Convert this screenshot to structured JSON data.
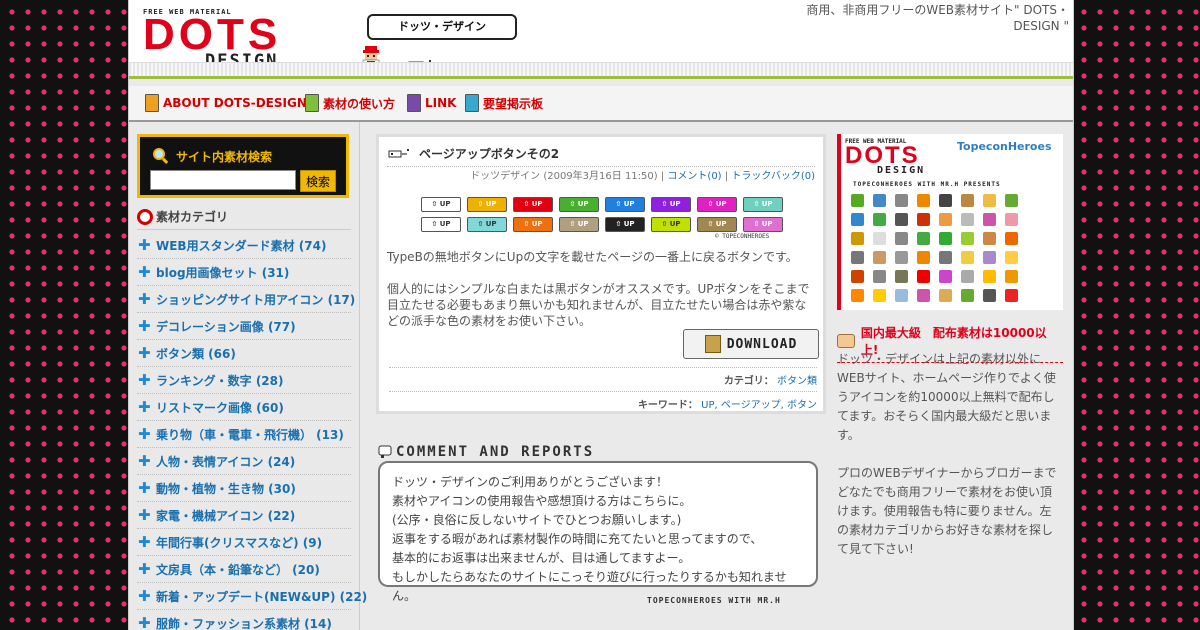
{
  "header": {
    "logo_free": "FREE WEB MATERIAL",
    "logo_dots": "DOTS",
    "logo_design": "DESIGN",
    "speech": "ドッツ・デザイン",
    "tagline": "商用、非商用フリーのWEB素材サイト\" DOTS・DESIGN \""
  },
  "nav": {
    "items": [
      {
        "label": "ABOUT DOTS-DESIGN",
        "color": "#f0a020"
      },
      {
        "label": "素材の使い方",
        "color": "#7dc13a"
      },
      {
        "label": "LINK",
        "color": "#7a4aa8"
      },
      {
        "label": "要望掲示板",
        "color": "#38a8d0"
      }
    ]
  },
  "sidebar": {
    "search_title": "サイト内素材検索",
    "search_button": "検索",
    "category_title": "素材カテゴリ",
    "categories": [
      "WEB用スタンダード素材 (74)",
      "blog用画像セット (31)",
      "ショッピングサイト用アイコン (17)",
      "デコレーション画像 (77)",
      "ボタン類 (66)",
      "ランキング・数字 (28)",
      "リストマーク画像 (60)",
      "乗り物（車・電車・飛行機） (13)",
      "人物・表情アイコン (24)",
      "動物・植物・生き物 (30)",
      "家電・機械アイコン (22)",
      "年間行事(クリスマスなど) (9)",
      "文房具（本・鉛筆など） (20)",
      "新着・アップデート(NEW&UP) (22)",
      "服飾・ファッション系素材 (14)"
    ]
  },
  "post": {
    "title": "ページアップボタンその2",
    "author": "ドッツデザイン",
    "date": "2009年3月16日 11:50",
    "comments": "コメント(0)",
    "trackbacks": "トラックバック(0)",
    "button_label": "UP",
    "credit": "TOPECONHEROES",
    "body_1": "TypeBの無地ボタンにUpの文字を載せたページの一番上に戻るボタンです。",
    "body_2": "個人的にはシンプルな白または黒ボタンがオススメです。UPボタンをそこまで目立たせる必要もあまり無いかも知れませんが、目立たせたい場合は赤や紫などの派手な色の素材をお使い下さい。",
    "download": "DOWNLOAD",
    "category_label": "カテゴリ：",
    "category_value": "ボタン類",
    "keyword_label": "キーワード：",
    "keywords": "UP, ページアップ, ボタン",
    "buttons_row1": [
      "#ffffff",
      "#f0b000",
      "#e00010",
      "#48b030",
      "#2080e0",
      "#9020e0",
      "#e020c0",
      "#70d0c0"
    ],
    "buttons_row2": [
      "#ffffff",
      "#80d8d8",
      "#f07010",
      "#b0a080",
      "#222222",
      "#c0e000",
      "#a08850",
      "#e070d0"
    ]
  },
  "comments": {
    "heading": "COMMENT AND REPORTS",
    "lines": [
      "ドッツ・デザインのご利用ありがとうございます！",
      "素材やアイコンの使用報告や感想頂ける方はこちらに。",
      "(公序・良俗に反しないサイトでひとつお願いします。)",
      "返事をする暇があれば素材製作の時間に充てたいと思ってますので、",
      "基本的にお返事は出来ませんが、目は通してますよー。",
      "もしかしたらあなたのサイトにこっそり遊びに行ったりするかも知れませ",
      "ん。"
    ],
    "credit": "TOPECONHEROES WITH MR.H"
  },
  "promo": {
    "logo_free": "FREE WEB MATERIAL",
    "logo_dots": "DOTS",
    "logo_design": "DESIGN",
    "topecon": "TopeconHeroes",
    "subtitle": "TOPECONHEROES WITH MR.H PRESENTS",
    "headline": "国内最大級　配布素材は10000以上!",
    "text_1": "ドッツ・デザインは上記の素材以外にWEBサイト、ホームページ作りでよく使うアイコンを約10000以上無料で配布してます。おそらく国内最大級だと思います。",
    "text_2": "プロのWEBデザイナーからブロガーまでどなたでも商用フリーで素材をお使い頂けます。使用報告も特に要りません。左の素材カテゴリからお好きな素材を探して見て下さい!",
    "icon_colors": [
      "#5a2",
      "#48c",
      "#888",
      "#e80",
      "#444",
      "#b84",
      "#eb4",
      "#6a3",
      "#38c",
      "#4a4",
      "#555",
      "#c30",
      "#e94",
      "#bbb",
      "#c5a",
      "#e9a",
      "#c90",
      "#ddd",
      "#888",
      "#4a4",
      "#3a3",
      "#9c3",
      "#c84",
      "#e60",
      "#777",
      "#c96",
      "#999",
      "#e80",
      "#777",
      "#ec4",
      "#a8c",
      "#fc4",
      "#c40",
      "#888",
      "#775",
      "#e00",
      "#c4c",
      "#aaa",
      "#fb0",
      "#e90",
      "#f80",
      "#fc0",
      "#9bd",
      "#c5a",
      "#da5",
      "#6a3",
      "#555",
      "#e22"
    ]
  }
}
